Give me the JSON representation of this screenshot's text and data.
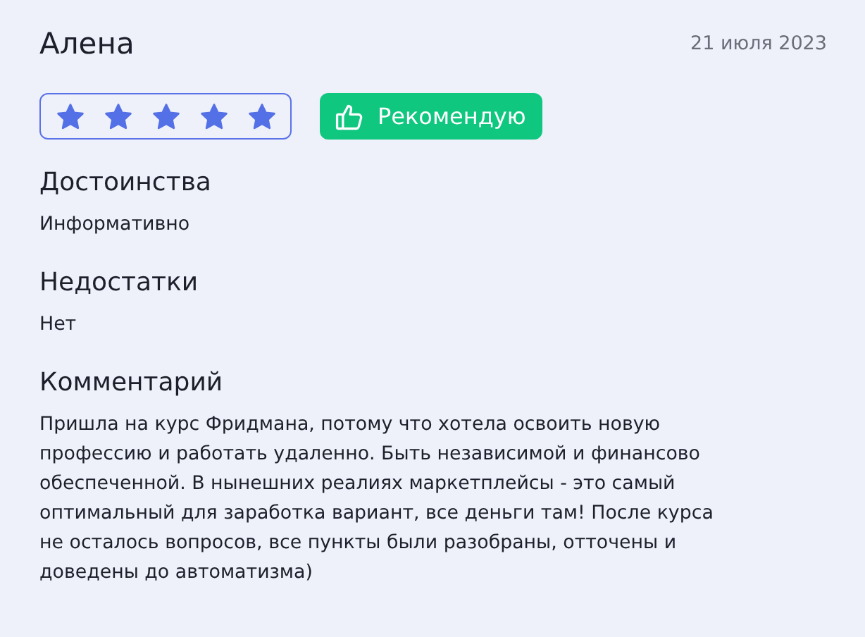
{
  "review": {
    "author": "Алена",
    "date": "21 июля 2023",
    "stars": 5,
    "recommend_label": "Рекомендую",
    "sections": [
      {
        "heading": "Достоинства",
        "text": "Информативно"
      },
      {
        "heading": "Недостатки",
        "text": "Нет"
      },
      {
        "heading": "Комментарий",
        "text": "Пришла на курс Фридмана, потому что хотела освоить новую профессию и работать удаленно. Быть независимой и финансово обеспеченной. В нынешних реалиях маркетплейсы - это самый оптимальный для заработка вариант, все деньги там! После курса не осталось вопросов, все пункты были разобраны, отточены и доведены до автоматизма)"
      }
    ]
  }
}
